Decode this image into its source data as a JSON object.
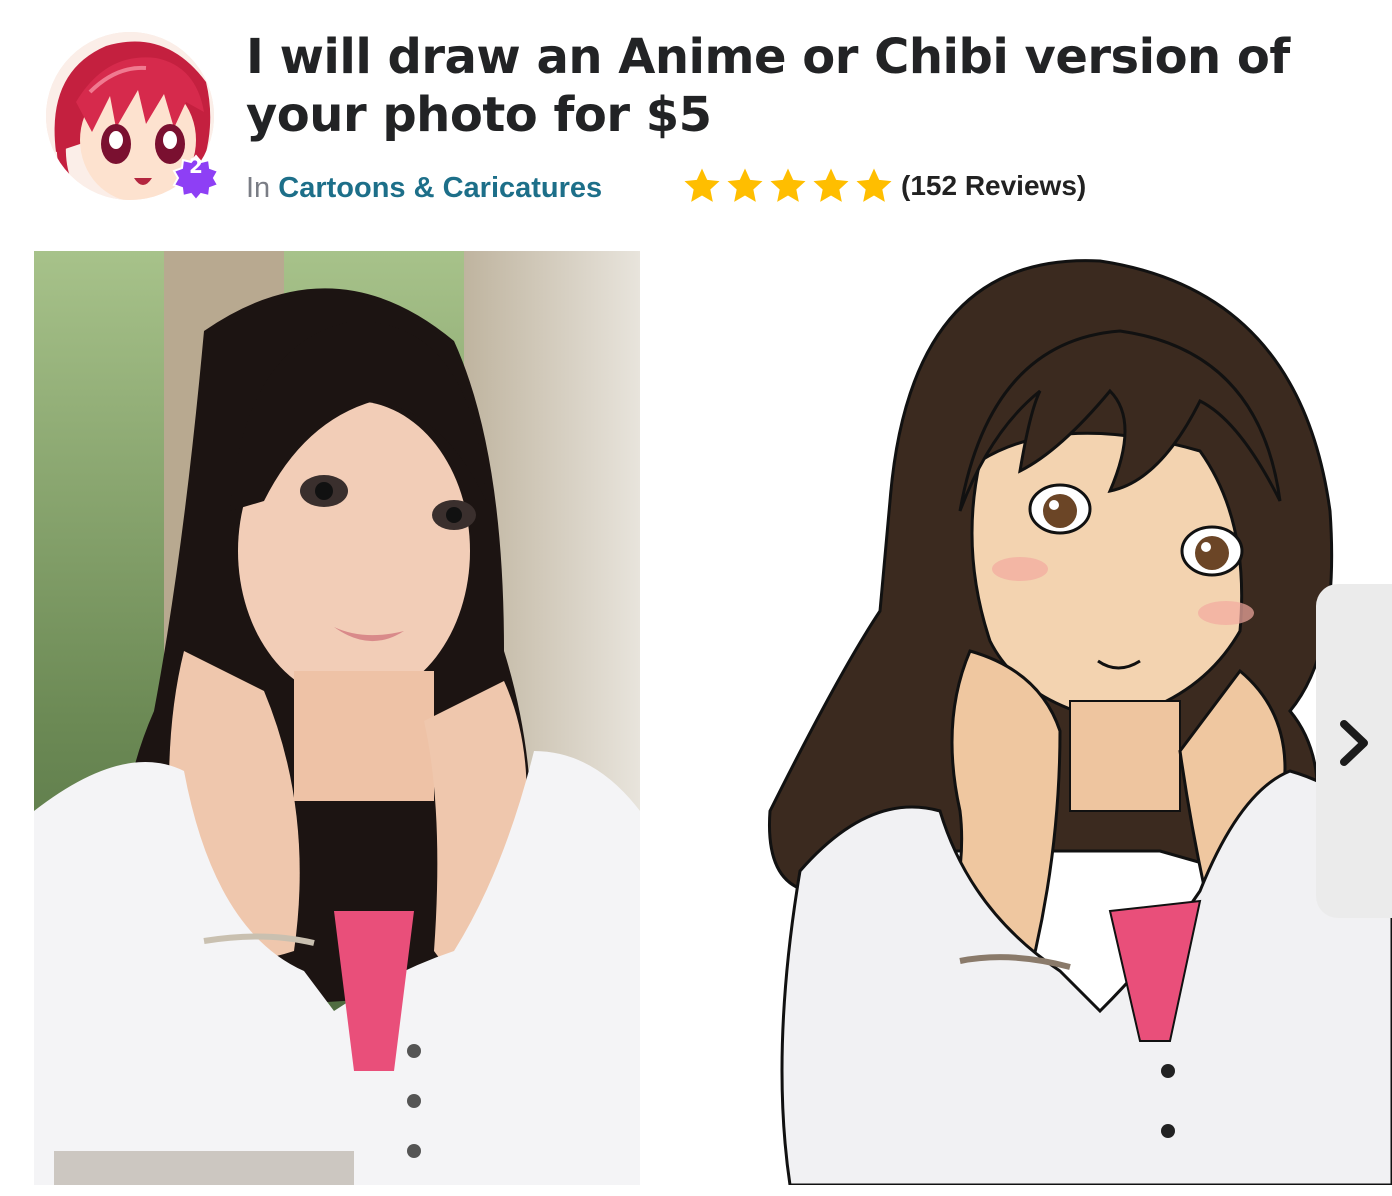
{
  "gig": {
    "title": "I will draw an Anime or Chibi version of your photo for $5",
    "category_prefix": "In",
    "category_name": "Cartoons & Caricatures",
    "seller_level": "2",
    "rating_stars": 5,
    "reviews_label": "(152 Reviews)"
  },
  "colors": {
    "star": "#ffbe00",
    "category_link": "#1d6f89",
    "badge": "#8e3ff5",
    "title": "#222325"
  },
  "icons": {
    "star": "star-icon",
    "next": "chevron-right-icon",
    "badge": "seller-level-badge-icon"
  }
}
